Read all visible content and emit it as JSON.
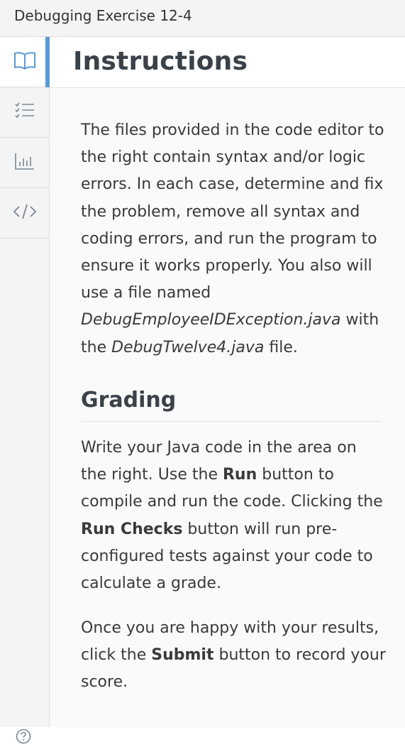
{
  "window": {
    "title": "Debugging Exercise 12-4"
  },
  "sidebar": {
    "items": [
      {
        "name": "instructions",
        "icon": "book-open-icon",
        "active": true
      },
      {
        "name": "checklist",
        "icon": "checklist-icon",
        "active": false
      },
      {
        "name": "results",
        "icon": "bar-chart-icon",
        "active": false
      },
      {
        "name": "code",
        "icon": "code-brackets-icon",
        "active": false
      }
    ],
    "help_icon": "question-circle-icon",
    "accent_color": "#5a9ad6"
  },
  "header": {
    "title": "Instructions"
  },
  "instructions": {
    "p1_part1": "The files provided in the code editor to the right contain syntax and/or logic errors. In each case, determine and fix the problem, remove all syntax and coding errors, and run the program to ensure it works properly. You also will use a file named ",
    "p1_file1": "DebugEmployeeIDException.java",
    "p1_part2": " with the ",
    "p1_file2": "DebugTwelve4.java",
    "p1_part3": " file."
  },
  "grading": {
    "title": "Grading",
    "p2_part1": "Write your Java code in the area on the right. Use the ",
    "p2_run": "Run",
    "p2_part2": " button to compile and run the code. Clicking the ",
    "p2_run_checks": "Run Checks",
    "p2_part3": " button will run pre-configured tests against your code to calculate a grade.",
    "p3_part1": "Once you are happy with your results, click the ",
    "p3_submit": "Submit",
    "p3_part2": " button to record your score."
  }
}
